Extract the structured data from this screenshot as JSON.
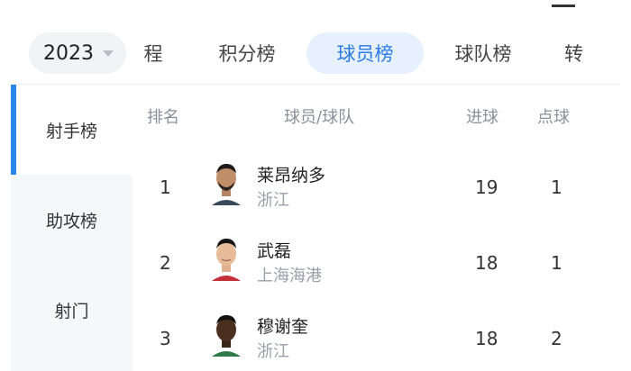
{
  "season": {
    "year": "2023"
  },
  "tabs": [
    {
      "label": "程"
    },
    {
      "label": "积分榜"
    },
    {
      "label": "球员榜"
    },
    {
      "label": "球队榜"
    },
    {
      "label": "转"
    }
  ],
  "sidebar": {
    "items": [
      {
        "label": "射手榜"
      },
      {
        "label": "助攻榜"
      },
      {
        "label": "射门"
      }
    ]
  },
  "table": {
    "headers": {
      "rank": "排名",
      "player": "球员/球队",
      "goals": "进球",
      "penalties": "点球"
    },
    "rows": [
      {
        "rank": "1",
        "name": "莱昂纳多",
        "team": "浙江",
        "goals": "19",
        "penalties": "1"
      },
      {
        "rank": "2",
        "name": "武磊",
        "team": "上海海港",
        "goals": "18",
        "penalties": "1"
      },
      {
        "rank": "3",
        "name": "穆谢奎",
        "team": "浙江",
        "goals": "18",
        "penalties": "2"
      }
    ]
  },
  "colors": {
    "accent": "#2a7be4",
    "accent_bg": "#e6f1fd",
    "sidebar_bg": "#f6f7f9",
    "muted": "#9aa0a8"
  }
}
